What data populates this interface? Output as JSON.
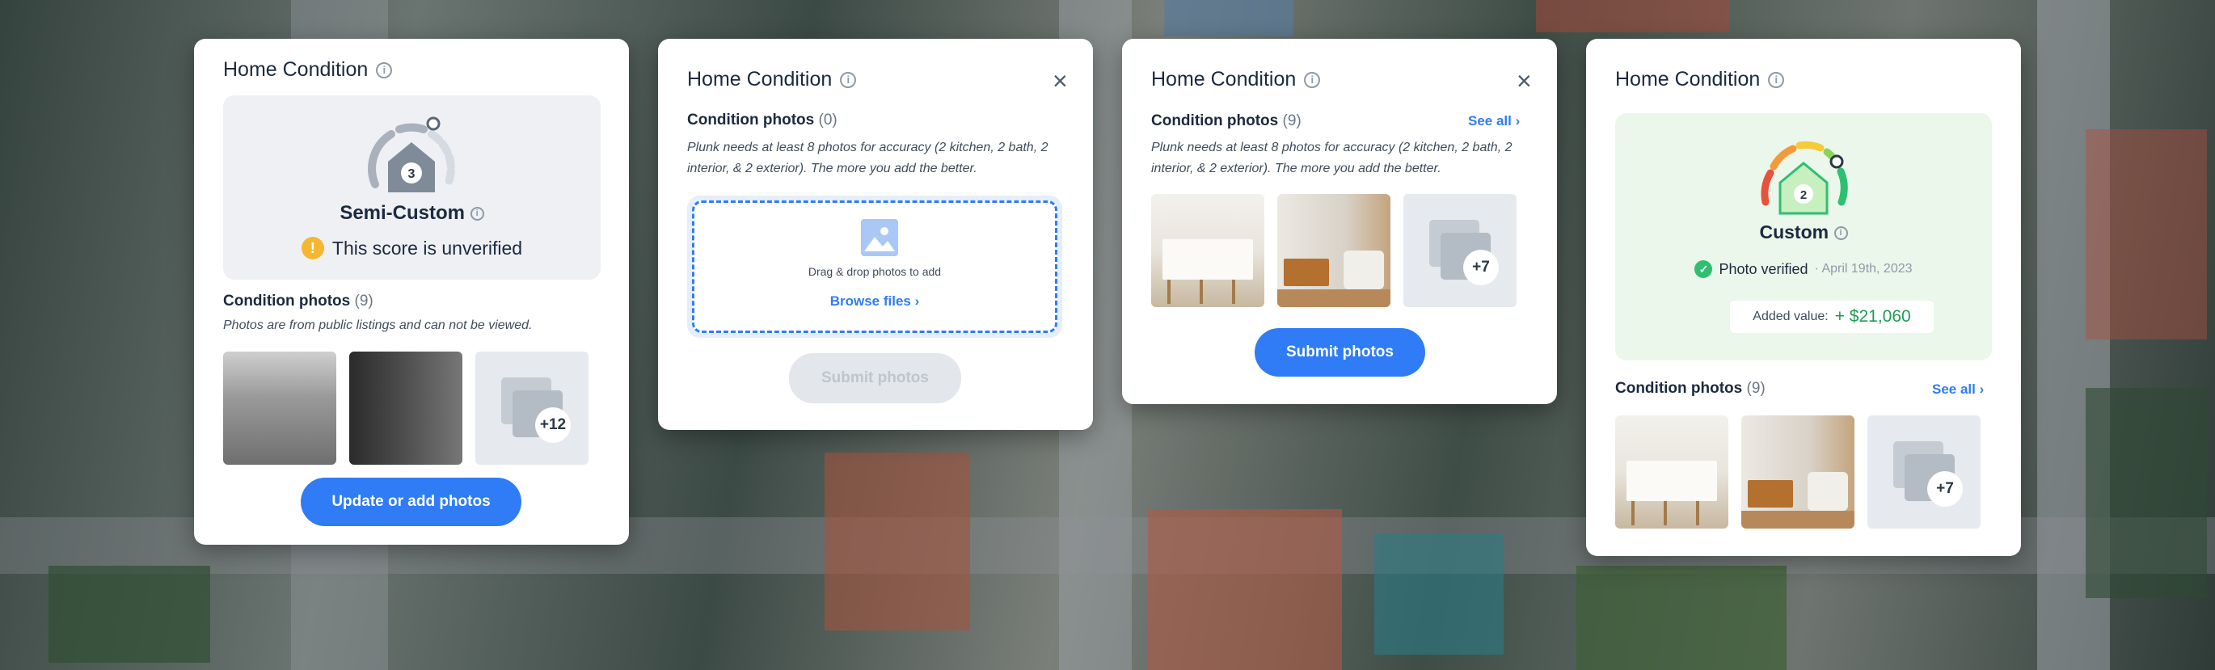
{
  "cards": [
    {
      "title": "Home Condition",
      "score_number": "3",
      "score_label": "Semi-Custom",
      "warning_text": "This score is unverified",
      "section_title": "Condition photos",
      "section_count": "(9)",
      "note": "Photos are from public listings and can not be viewed.",
      "more_count": "+12",
      "button_label": "Update or add photos"
    },
    {
      "title": "Home Condition",
      "section_title": "Condition photos",
      "section_count": "(0)",
      "note": "Plunk needs at least 8 photos for accuracy (2 kitchen, 2 bath, 2 interior, & 2 exterior). The more you add the better.",
      "drop_text": "Drag & drop photos to add",
      "browse_label": "Browse files",
      "button_label": "Submit photos"
    },
    {
      "title": "Home Condition",
      "section_title": "Condition photos",
      "section_count": "(9)",
      "see_all": "See all",
      "note": "Plunk needs at least 8 photos for accuracy (2 kitchen, 2 bath, 2 interior, & 2 exterior). The more you add the better.",
      "more_count": "+7",
      "button_label": "Submit photos"
    },
    {
      "title": "Home Condition",
      "score_number": "2",
      "score_label": "Custom",
      "verified_text": "Photo verified",
      "verified_date": "· April 19th, 2023",
      "added_value_label": "Added value:",
      "added_value_amount": "+ $21,060",
      "section_title": "Condition photos",
      "section_count": "(9)",
      "see_all": "See all",
      "more_count": "+7"
    }
  ],
  "icons": {
    "info": "info-icon",
    "close": "close-icon",
    "warning": "warning-icon",
    "image": "image-icon",
    "chevron": "chevron-right-icon",
    "check": "check-badge-icon",
    "house": "house-icon"
  },
  "colors": {
    "accent": "#2f7cf6",
    "warning": "#f5b731",
    "verified": "#2fbf71",
    "added_value": "#1f9b52",
    "verified_panel": "#eaf7ea"
  }
}
